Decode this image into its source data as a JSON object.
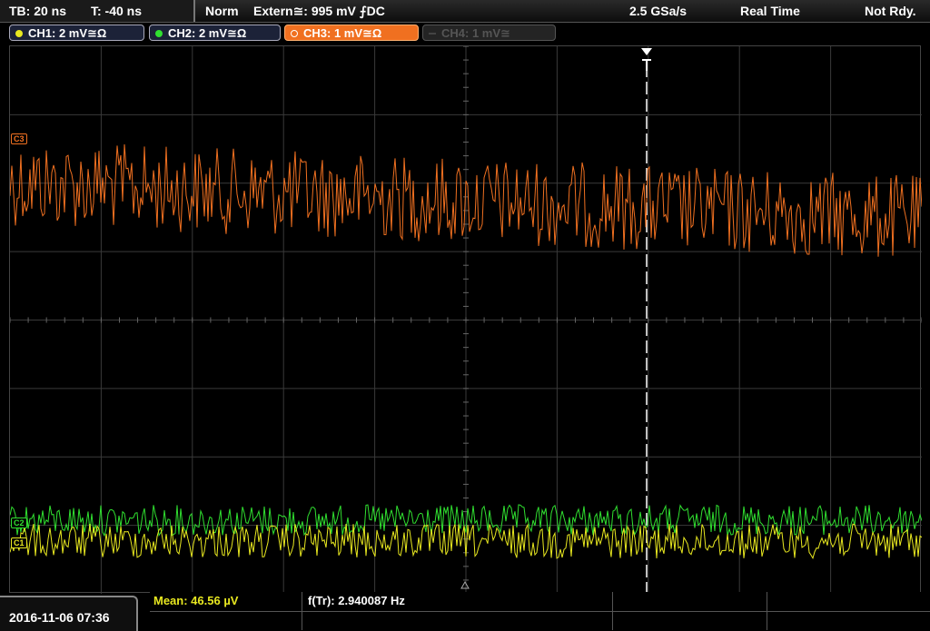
{
  "topbar": {
    "timebase": "TB: 20 ns",
    "trigger_time": "T: -40 ns",
    "trigger_mode": "Norm",
    "trigger_source": "Extern≅: 995 mV ⨍DC",
    "sample_rate": "2.5 GSa/s",
    "acq_mode": "Real Time",
    "status": "Not Rdy."
  },
  "channels": [
    {
      "label": "CH1: 2 mV≅Ω",
      "color": "#e8e820",
      "active": true
    },
    {
      "label": "CH2: 2 mV≅Ω",
      "color": "#30e030",
      "active": true
    },
    {
      "label": "CH3: 1 mV≅Ω",
      "color": "#f07020",
      "active": true
    },
    {
      "label": "CH4: 1 mV≅",
      "color": "#555555",
      "active": false
    }
  ],
  "level_markers": {
    "ch3": "C3",
    "ch2": "C2",
    "ch1": "C1"
  },
  "measurements": {
    "mean": "Mean: 46.56 µV",
    "freq": "f(Tr): 2.940087 Hz"
  },
  "datetime": "2016-11-06 07:36",
  "colors": {
    "grid": "#3a3a3a",
    "ch1": "#e8e820",
    "ch2": "#30e030",
    "ch3": "#f07020"
  },
  "icons": {
    "trigger": "trigger-T-icon",
    "trigger_bottom": "trigger-position-icon"
  }
}
